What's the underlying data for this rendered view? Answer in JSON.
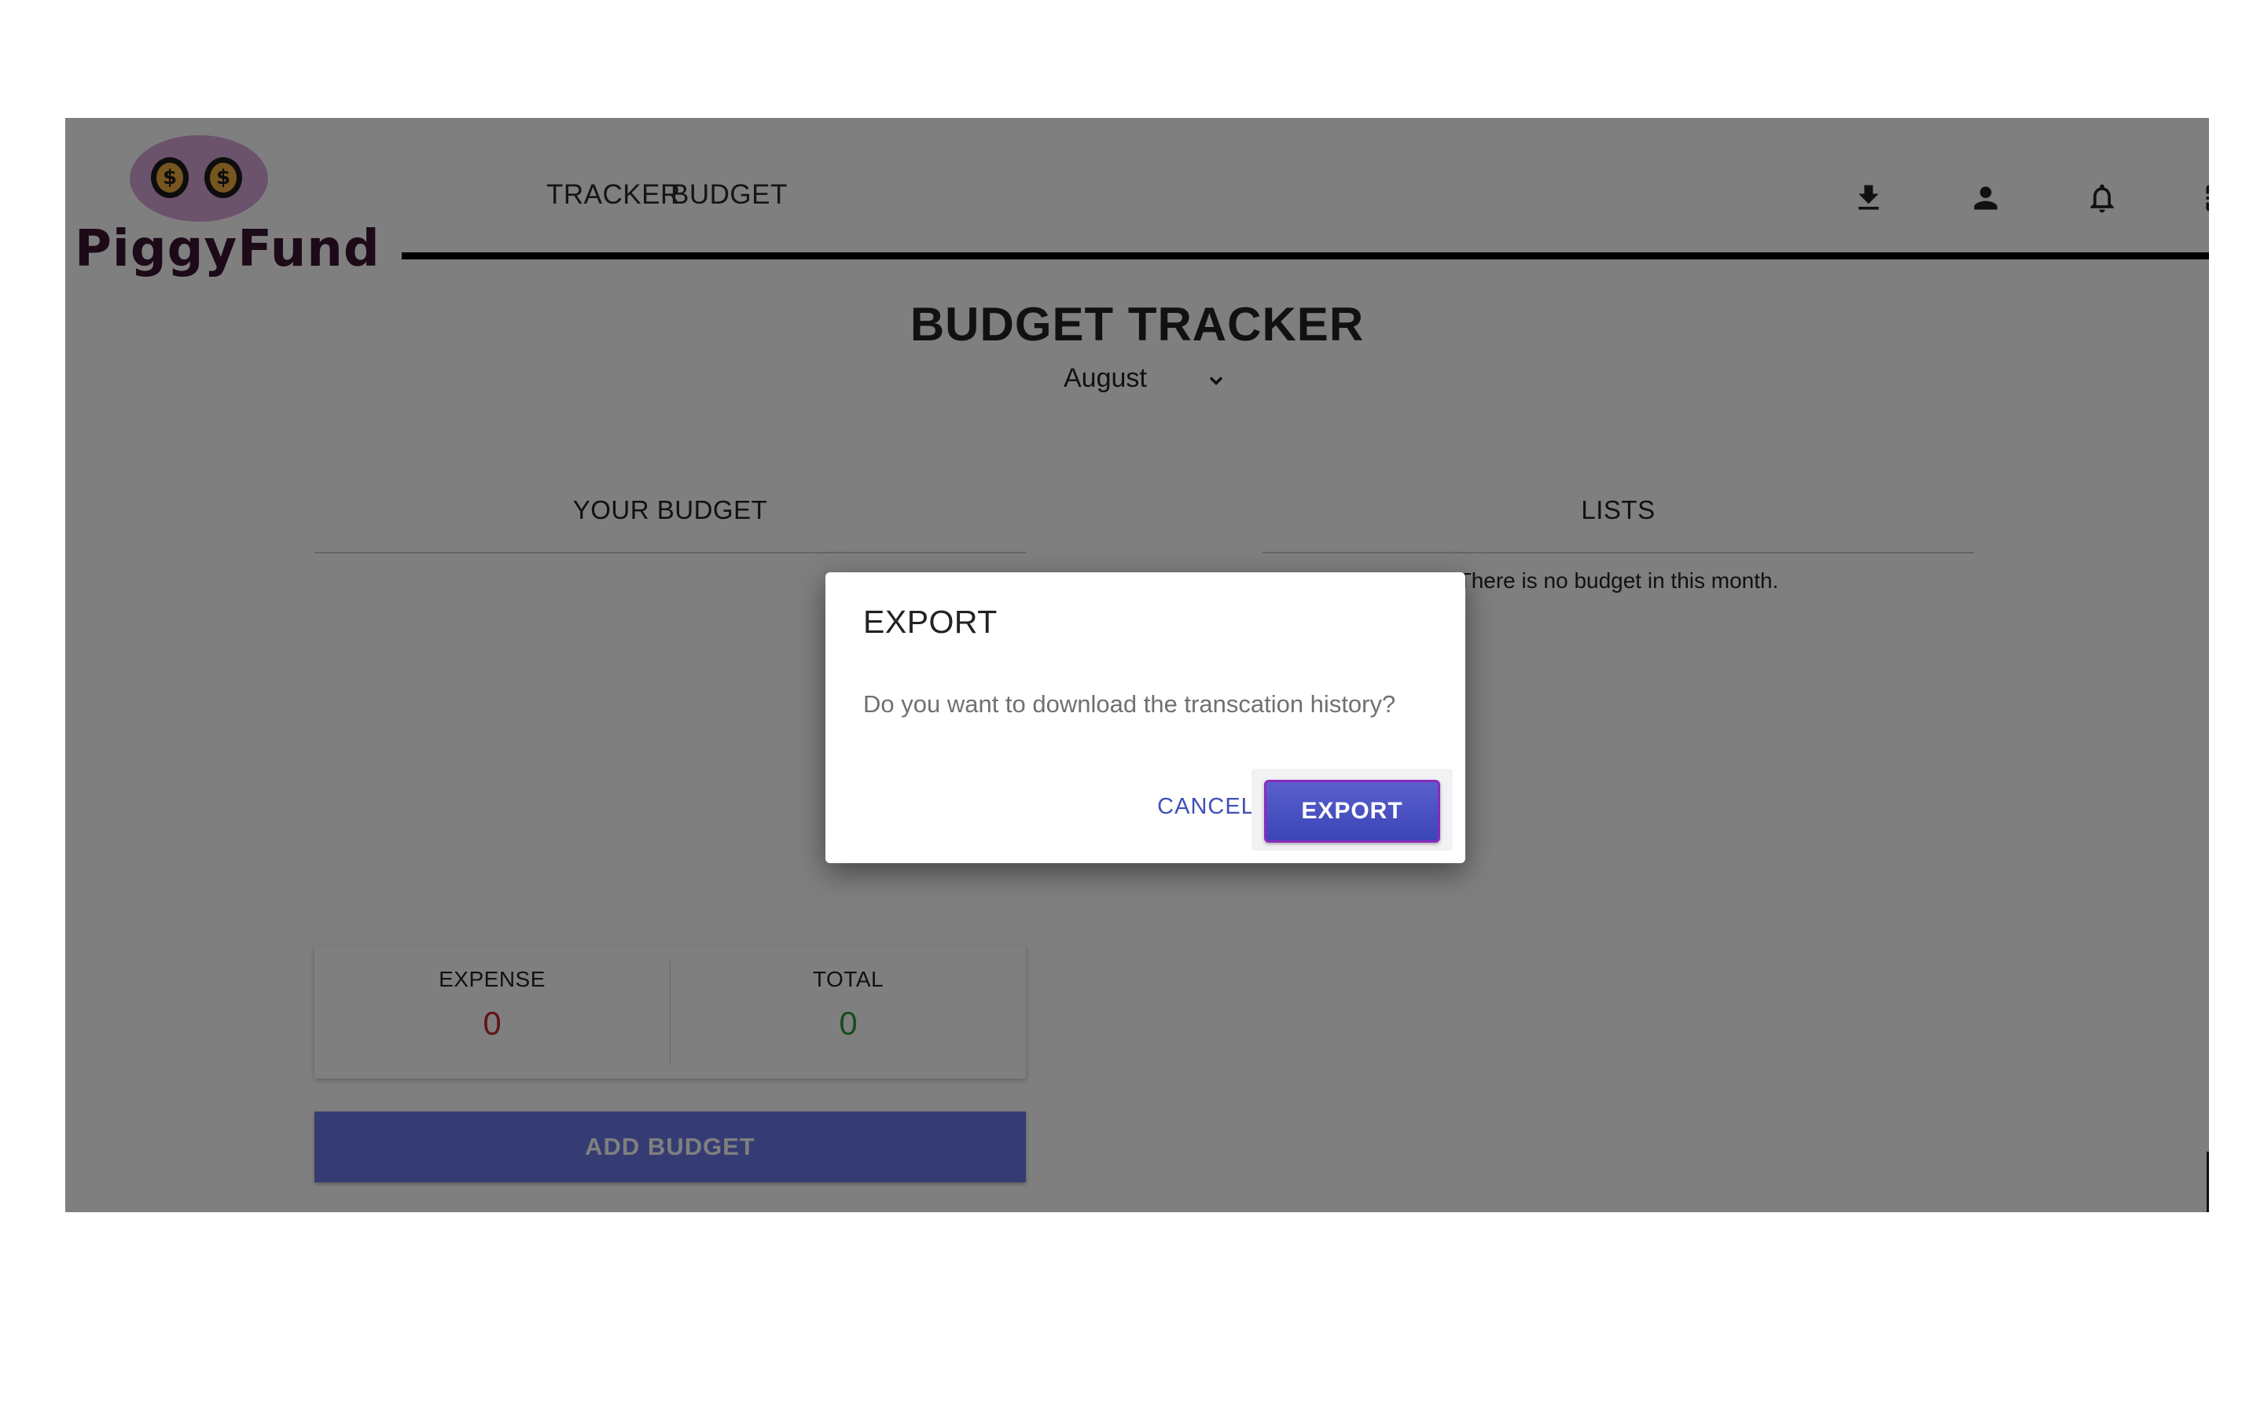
{
  "brand": {
    "name": "PiggyFund",
    "coin_symbol": "$",
    "oval_color": "#d6a6d9",
    "coin_color": "#efaa3e"
  },
  "nav": {
    "links": [
      "TRACKER",
      "BUDGET"
    ],
    "icons": [
      "download-icon",
      "user-icon",
      "bell-icon",
      "logout-icon"
    ]
  },
  "page": {
    "title": "BUDGET TRACKER",
    "month": "August"
  },
  "budget_section": {
    "heading": "YOUR BUDGET",
    "expense_label": "EXPENSE",
    "expense_value": "0",
    "total_label": "TOTAL",
    "total_value": "0",
    "add_button": "ADD BUDGET"
  },
  "lists_section": {
    "heading": "LISTS",
    "empty_message": "There is no budget in this month."
  },
  "dialog": {
    "title": "EXPORT",
    "message": "Do you want to download the transcation history?",
    "cancel_label": "CANCEL",
    "export_label": "EXPORT"
  },
  "colors": {
    "accent": "#3f51b5",
    "expense": "#c62828",
    "total": "#2e9d45",
    "add_button": "#6b78e6"
  }
}
